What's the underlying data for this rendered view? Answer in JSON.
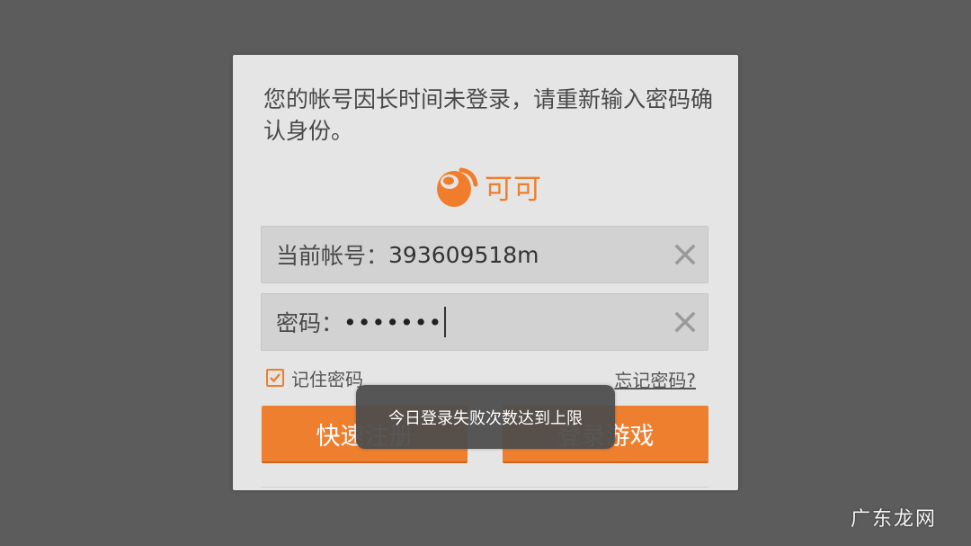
{
  "dialog": {
    "message": "您的帐号因长时间未登录，请重新输入密码确认身份。",
    "logo": {
      "text": "可可",
      "icon": "keke-logo-icon",
      "color": "#f07d2c"
    },
    "account_field": {
      "label": "当前帐号：",
      "value": "393609518m",
      "clear_icon": "clear-x-icon"
    },
    "password_field": {
      "label": "密码：",
      "masked_value": "•••••••",
      "clear_icon": "clear-x-icon"
    },
    "remember_password": {
      "label": "记住密码",
      "checked": true
    },
    "forgot_password_link": "忘记密码?",
    "buttons": {
      "register": "快速注册",
      "login": "登录游戏"
    },
    "accent_color": "#ee7f2f"
  },
  "toast": {
    "text": "今日登录失败次数达到上限"
  },
  "watermark": "广东龙网"
}
